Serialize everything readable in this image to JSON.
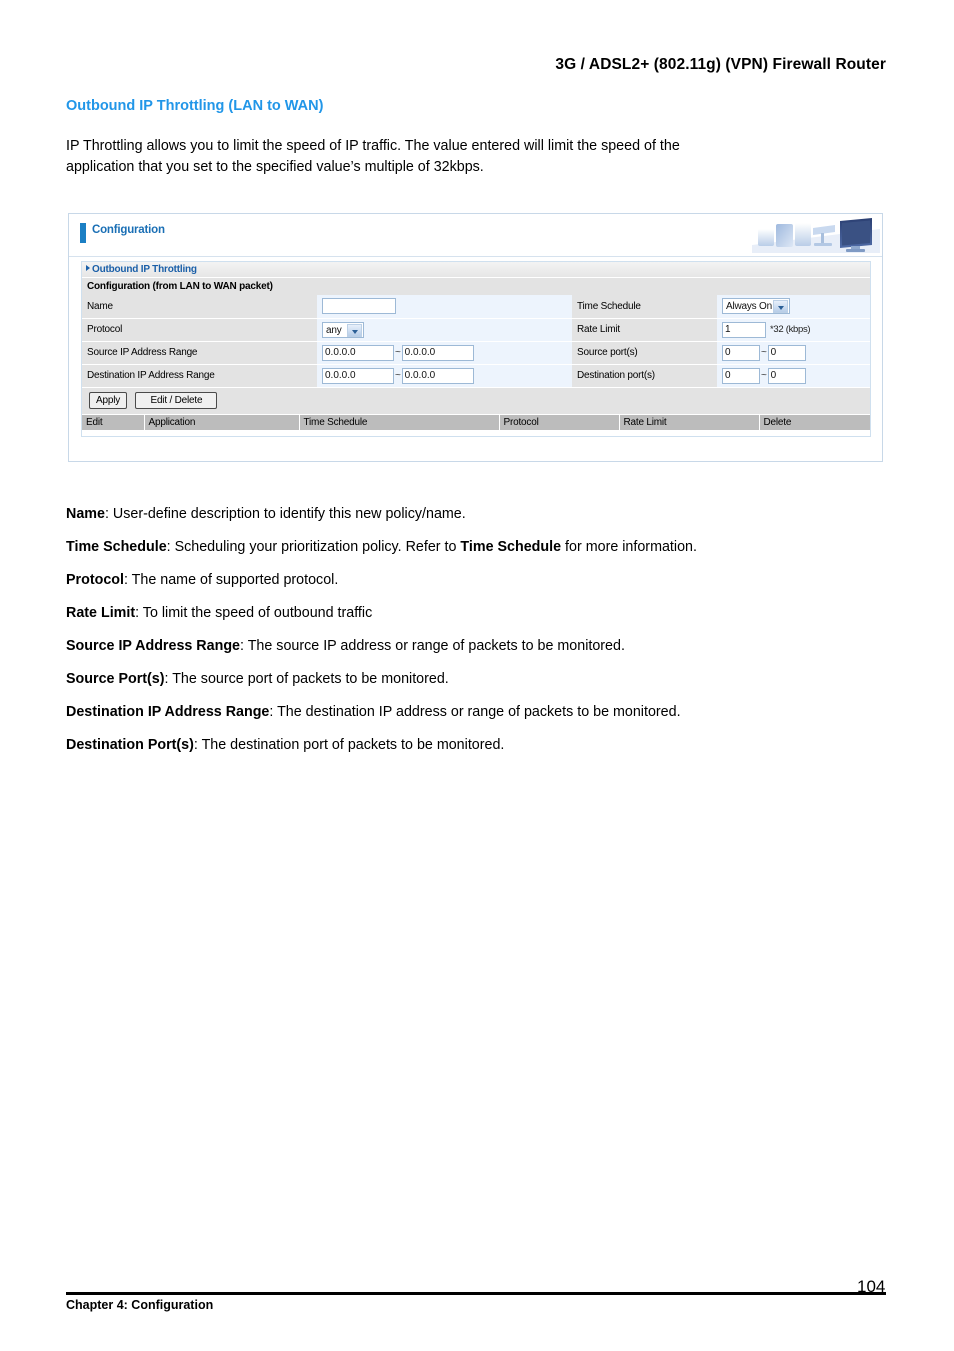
{
  "document": {
    "header_title": "3G / ADSL2+ (802.11g) (VPN) Firewall Router",
    "section_title": "Outbound IP Throttling (LAN to WAN)",
    "intro_line1": "IP Throttling allows you to limit the speed of IP traffic. The value entered will limit the speed of the",
    "intro_line2": "application that you set to the specified value’s multiple of 32kbps."
  },
  "panel": {
    "title": "Configuration",
    "banner_icon": "office-computers-image",
    "subsection": "Outbound IP Throttling",
    "subsection_arrow_icon": "triangle-right-icon",
    "config_caption": "Configuration (from LAN to WAN packet)",
    "form": {
      "name_label": "Name",
      "name_value": "",
      "time_schedule_label": "Time Schedule",
      "time_schedule_value": "Always On",
      "protocol_label": "Protocol",
      "protocol_value": "any",
      "rate_limit_label": "Rate Limit",
      "rate_limit_value": "1",
      "rate_limit_unit": "*32 (kbps)",
      "source_ip_label": "Source IP Address Range",
      "source_ip_from": "0.0.0.0",
      "source_ip_to": "0.0.0.0",
      "source_port_label": "Source port(s)",
      "source_port_from": "0",
      "source_port_to": "0",
      "dest_ip_label": "Destination IP Address Range",
      "dest_ip_from": "0.0.0.0",
      "dest_ip_to": "0.0.0.0",
      "dest_port_label": "Destination port(s)",
      "dest_port_from": "0",
      "dest_port_to": "0",
      "range_separator": "~"
    },
    "buttons": {
      "apply": "Apply",
      "edit_delete": "Edit / Delete"
    },
    "result_table": {
      "columns": [
        "Edit",
        "Application",
        "Time Schedule",
        "Protocol",
        "Rate Limit",
        "Delete"
      ],
      "rows": []
    }
  },
  "definitions": [
    {
      "term": "Name",
      "desc": ": User-define description to identify this new policy/name."
    },
    {
      "term": "Time Schedule",
      "desc_a": ": Scheduling your prioritization policy. Refer to ",
      "term_b": "Time Schedule",
      "desc_b": " for more information."
    },
    {
      "term": "Protocol",
      "desc": ": The name of supported protocol."
    },
    {
      "term": "Rate Limit",
      "desc": ": To limit the speed of outbound traffic"
    },
    {
      "term": "Source IP Address Range",
      "desc": ": The source IP address or range of packets to be monitored."
    },
    {
      "term": "Source Port(s)",
      "desc": ": The source port of packets to be monitored."
    },
    {
      "term": "Destination IP Address Range",
      "desc": ": The destination IP address or range of packets to be monitored."
    },
    {
      "term": "Destination Port(s)",
      "desc": ": The destination port of packets to be monitored."
    }
  ],
  "footer": {
    "chapter": "Chapter 4: Configuration",
    "page_number": "104"
  },
  "colors": {
    "accent_blue": "#2196e8",
    "panel_title_blue": "#1a6fb5",
    "label_gray": "#e3e3e3",
    "field_blue": "#edf4fd",
    "table_header_gray": "#bcbcbc"
  }
}
